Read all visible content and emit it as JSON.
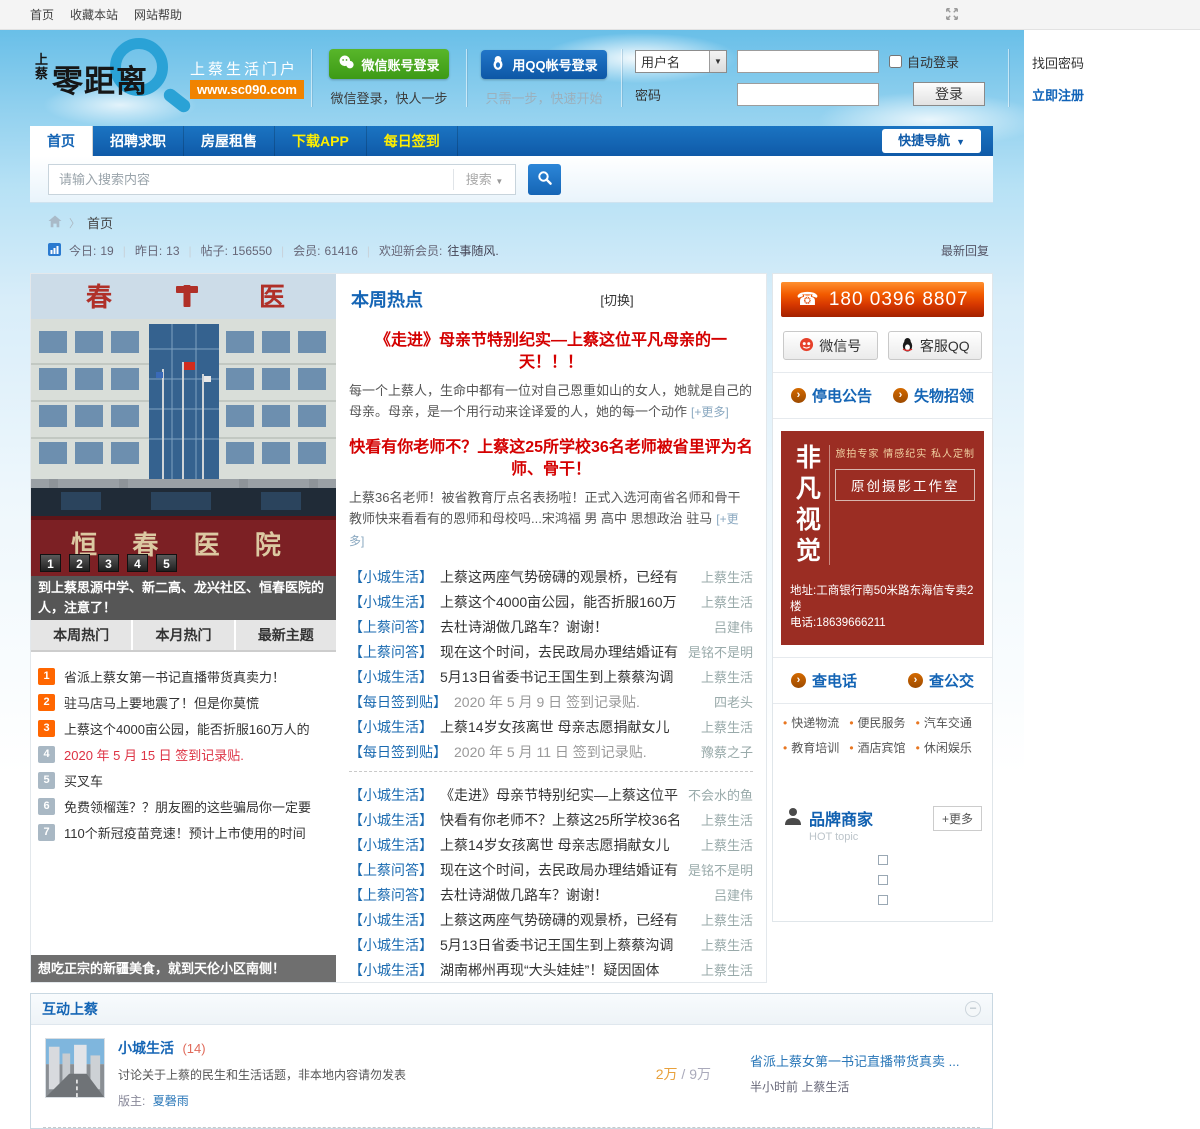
{
  "topbar": {
    "links": [
      "首页",
      "收藏本站",
      "网站帮助"
    ]
  },
  "header": {
    "logo_prefix": "上蔡",
    "logo_main": "零距离",
    "tagline": "上蔡生活门户",
    "url": "www.sc090.com",
    "wechat_btn": "微信账号登录",
    "wechat_sub": "微信登录，快人一步",
    "qq_btn": "用QQ帐号登录",
    "qq_sub": "只需一步，快速开始",
    "login": {
      "username_label": "用户名",
      "password_label": "密码",
      "auto_login": "自动登录",
      "find_password": "找回密码",
      "login_btn": "登录",
      "register": "立即注册"
    }
  },
  "nav": {
    "tabs": [
      {
        "label": "首页",
        "cls": "active"
      },
      {
        "label": "招聘求职",
        "cls": ""
      },
      {
        "label": "房屋租售",
        "cls": ""
      },
      {
        "label": "下载APP",
        "cls": "yellow"
      },
      {
        "label": "每日签到",
        "cls": "yellow"
      }
    ],
    "quick": "快捷导航",
    "caret": "▼"
  },
  "search": {
    "placeholder": "请输入搜索内容",
    "type_label": "搜索",
    "caret": "▼"
  },
  "breadcrumb": {
    "sep": "〉",
    "home": "首页"
  },
  "stats": {
    "items": [
      {
        "label": "今日:",
        "value": "19"
      },
      {
        "label": "昨日:",
        "value": "13"
      },
      {
        "label": "帖子:",
        "value": "156550"
      },
      {
        "label": "会员:",
        "value": "61416"
      }
    ],
    "welcome_label": "欢迎新会员:",
    "welcome_user": "往事随风.",
    "latest": "最新回复"
  },
  "carousel": {
    "pages": [
      "1",
      "2",
      "3",
      "4",
      "5"
    ],
    "caption": "到上蔡思源中学、新二高、龙兴社区、恒春医院的人，注意了！",
    "photo_roof_left": "春",
    "photo_roof_right": "医",
    "photo_sign": "恒 春 医 院"
  },
  "left_tabs": [
    "本周热门",
    "本月热门",
    "最新主题"
  ],
  "hot_list": [
    {
      "rank": "1",
      "text": "省派上蔡女第一书记直播带货真卖力！",
      "badge": "hot",
      "cls": ""
    },
    {
      "rank": "2",
      "text": "驻马店马上要地震了！但是你莫慌",
      "badge": "hot",
      "cls": ""
    },
    {
      "rank": "3",
      "text": "上蔡这个4000亩公园，能否折服160万人的",
      "badge": "hot",
      "cls": ""
    },
    {
      "rank": "4",
      "text": "2020 年 5 月 15 日 签到记录贴.",
      "badge": "dim",
      "cls": "red"
    },
    {
      "rank": "5",
      "text": "买叉车",
      "badge": "dim",
      "cls": ""
    },
    {
      "rank": "6",
      "text": "免费领榴莲？？朋友圈的这些骗局你一定要",
      "badge": "dim",
      "cls": ""
    },
    {
      "rank": "7",
      "text": "110个新冠疫苗竞速！预计上市使用的时间",
      "badge": "dim",
      "cls": ""
    }
  ],
  "left_banner": "想吃正宗的新疆美食，就到天伦小区南侧！",
  "weekly": {
    "title": "本周热点",
    "switch": "[切换]",
    "feature1": {
      "title": "《走进》母亲节特别纪实—上蔡这位平凡母亲的一天！！！",
      "body": "每一个上蔡人，生命中都有一位对自己恩重如山的女人，她就是自己的母亲。母亲，是一个用行动来诠译爱的人，她的每一个动作",
      "more": "[+更多]"
    },
    "feature2": {
      "title": "快看有你老师不？上蔡这25所学校36名老师被省里评为名师、骨干！",
      "body": "上蔡36名老师！被省教育厅点名表扬啦！正式入选河南省名师和骨干教师快来看看有的恩师和母校吗...宋鸿福 男 高中 思想政治 驻马",
      "more": "[+更多]"
    },
    "list1": [
      {
        "cat": "【小城生活】",
        "title": "上蔡这两座气势磅礴的观景桥，已经有",
        "author": "上蔡生活",
        "cls": ""
      },
      {
        "cat": "【小城生活】",
        "title": "上蔡这个4000亩公园，能否折服160万",
        "author": "上蔡生活",
        "cls": ""
      },
      {
        "cat": "【上蔡问答】",
        "title": "去杜诗湖做几路车？谢谢！",
        "author": "吕建伟",
        "cls": ""
      },
      {
        "cat": "【上蔡问答】",
        "title": "现在这个时间，去民政局办理结婚证有",
        "author": "是铭不是明",
        "cls": ""
      },
      {
        "cat": "【小城生活】",
        "title": "5月13日省委书记王国生到上蔡蔡沟调",
        "author": "上蔡生活",
        "cls": ""
      },
      {
        "cat": "【每日签到贴】",
        "title": "2020 年 5 月 9 日 签到记录贴.",
        "author": "四老头",
        "cls": "dim"
      },
      {
        "cat": "【小城生活】",
        "title": "上蔡14岁女孩离世 母亲志愿捐献女儿",
        "author": "上蔡生活",
        "cls": ""
      },
      {
        "cat": "【每日签到贴】",
        "title": "2020 年 5 月 11 日 签到记录贴.",
        "author": "豫蔡之子",
        "cls": "dim"
      }
    ],
    "list2": [
      {
        "cat": "【小城生活】",
        "title": "《走进》母亲节特别纪实—上蔡这位平",
        "author": "不会水的鱼",
        "cls": ""
      },
      {
        "cat": "【小城生活】",
        "title": "快看有你老师不？上蔡这25所学校36名",
        "author": "上蔡生活",
        "cls": ""
      },
      {
        "cat": "【小城生活】",
        "title": "上蔡14岁女孩离世 母亲志愿捐献女儿",
        "author": "上蔡生活",
        "cls": ""
      },
      {
        "cat": "【上蔡问答】",
        "title": "现在这个时间，去民政局办理结婚证有",
        "author": "是铭不是明",
        "cls": ""
      },
      {
        "cat": "【上蔡问答】",
        "title": "去杜诗湖做几路车？谢谢！",
        "author": "吕建伟",
        "cls": ""
      },
      {
        "cat": "【小城生活】",
        "title": "上蔡这两座气势磅礴的观景桥，已经有",
        "author": "上蔡生活",
        "cls": ""
      },
      {
        "cat": "【小城生活】",
        "title": "5月13日省委书记王国生到上蔡蔡沟调",
        "author": "上蔡生活",
        "cls": ""
      },
      {
        "cat": "【小城生活】",
        "title": "湖南郴州再现“大头娃娃”！疑因固体",
        "author": "上蔡生活",
        "cls": ""
      }
    ]
  },
  "sidebar": {
    "phone": "180 0396 8807",
    "wechat_id_btn": "微信号",
    "qq_service_btn": "客服QQ",
    "notices": [
      "停电公告",
      "失物招领"
    ],
    "ad": {
      "name_line1": "非凡",
      "name_line2": "视觉",
      "tags": "旅拍专家 情感纪实 私人定制",
      "box": "原创摄影工作室",
      "address": "地址:工商银行南50米路东海信专卖2楼",
      "tel": "电话:18639666211"
    },
    "lookups": [
      "查电话",
      "查公交"
    ],
    "services": [
      "快递物流",
      "便民服务",
      "汽车交通",
      "教育培训",
      "酒店宾馆",
      "休闲娱乐"
    ],
    "brand": {
      "title": "品牌商家",
      "sub": "HOT topic",
      "more": "+更多"
    }
  },
  "bottom": {
    "title": "互动上蔡",
    "forum": {
      "name": "小城生活",
      "count": "(14)",
      "desc": "讨论关于上蔡的民生和生活话题，非本地内容请勿发表",
      "mod_label": "版主:",
      "moderator": "夏磬雨",
      "threads": "2万",
      "sep": " / ",
      "posts": "9万",
      "last_title": "省派上蔡女第一书记直播带货真卖 ...",
      "last_meta": "半小时前 上蔡生活"
    }
  },
  "colors": {
    "nav_blue": "#1565b5",
    "link_blue": "#2a6db0",
    "headline_red": "#d40000",
    "badge_orange": "#ff6600",
    "banner_orange": "#e84a00",
    "ad_red": "#9b2d23",
    "nav_yellow": "#ffee00"
  }
}
